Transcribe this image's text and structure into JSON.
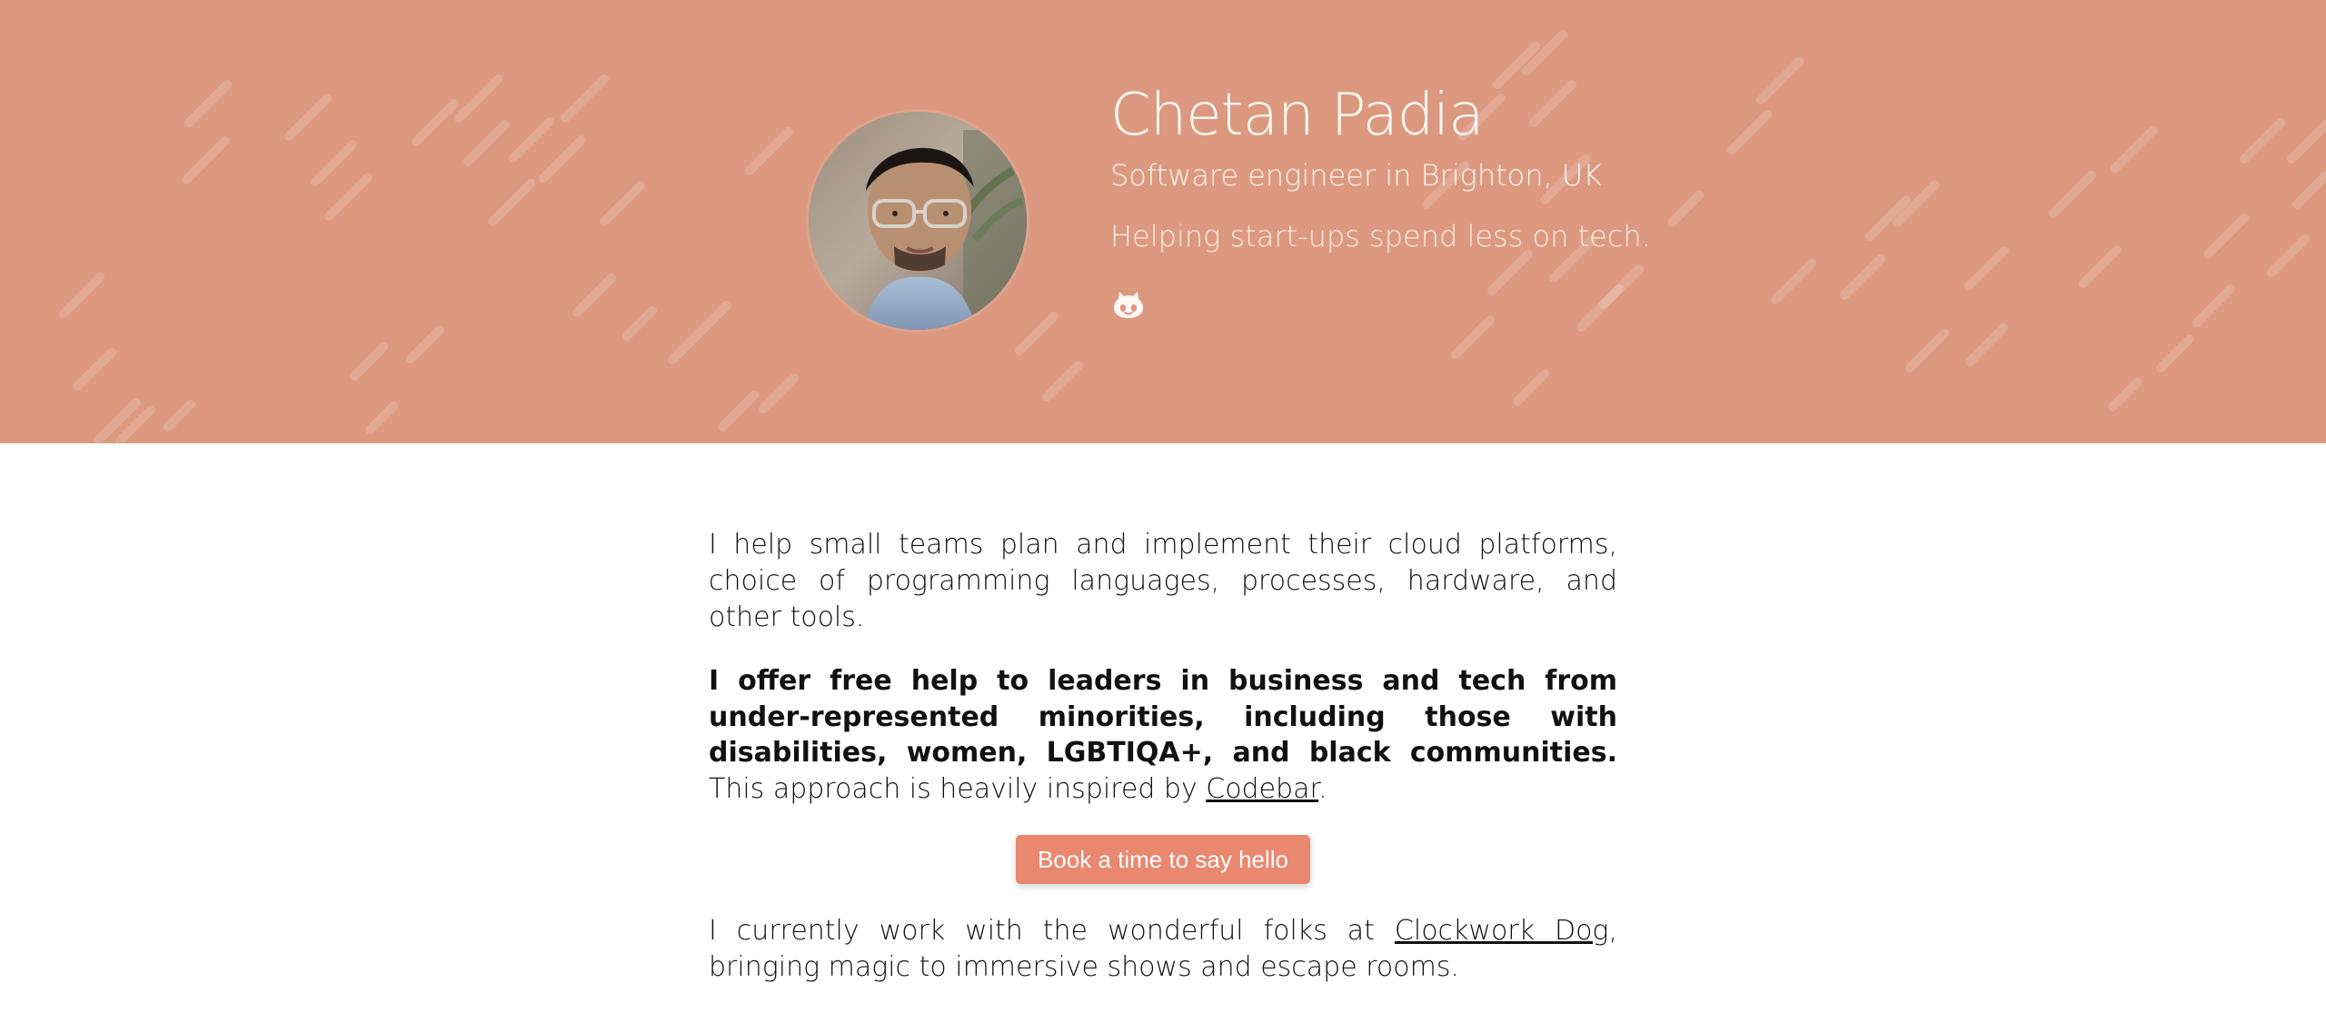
{
  "hero": {
    "name": "Chetan Padia",
    "subtitle": "Software engineer in Brighton, UK",
    "tagline": "Helping start-ups spend less on tech.",
    "github_icon": "github-icon",
    "colors": {
      "background": "#dc9980",
      "text": "#fff8f3"
    }
  },
  "content": {
    "intro": "I help small teams plan and implement their cloud platforms, choice of programming languages, processes, hardware, and other tools.",
    "offer_bold": "I offer free help to leaders in business and tech from under-represented minorities, including those with disabilities, women, LGBTIQA+, and black communities.",
    "offer_tail_prefix": " This approach is heavily inspired by ",
    "offer_link": "Codebar",
    "offer_tail_suffix": ".",
    "cta_label": "Book a time to say hello",
    "work_prefix": "I currently work with the wonderful folks at ",
    "work_link": "Clockwork Dog",
    "work_suffix": ", bringing magic to immersive shows and escape rooms."
  }
}
